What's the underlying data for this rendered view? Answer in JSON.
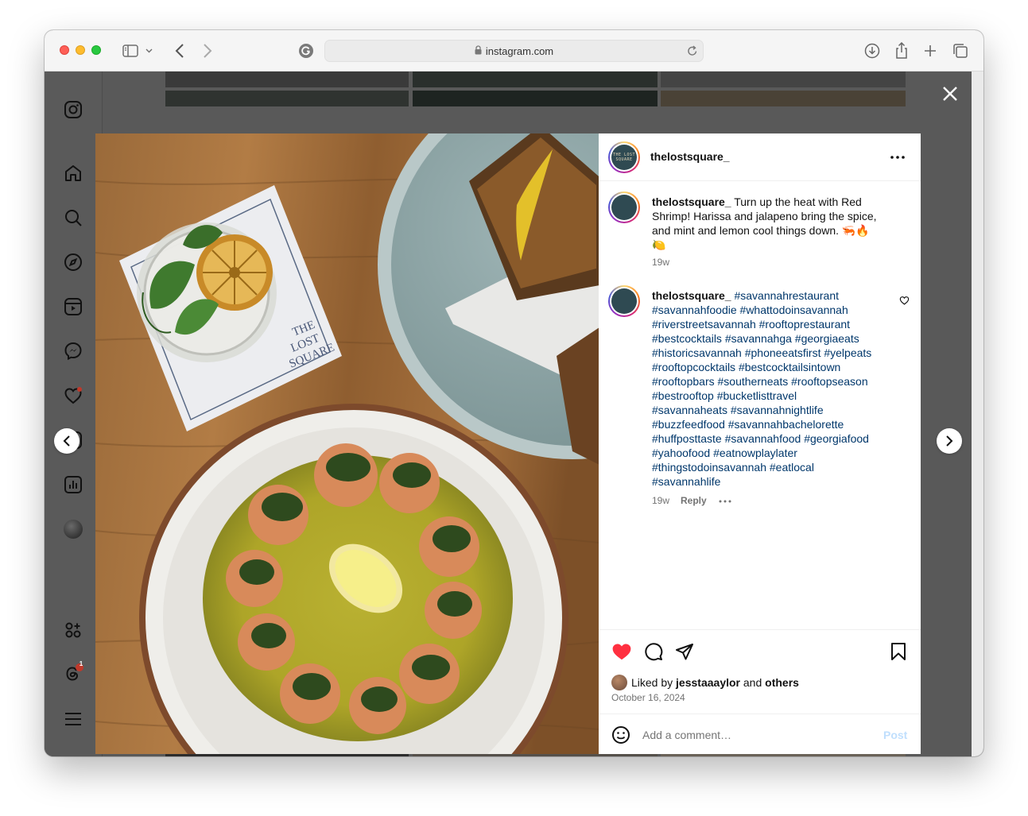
{
  "browser": {
    "url": "instagram.com"
  },
  "post": {
    "username": "thelostsquare_",
    "avatar_text": "THE LOST SQUARE",
    "caption_user": "thelostsquare_",
    "caption_line1": "Turn up the heat with Red",
    "caption_line2": "Shrimp! Harissa and jalapeno bring the spice,",
    "caption_line3": "and mint and lemon cool things down. 🦐🔥",
    "caption_line4": "🍋",
    "caption_time": "19w",
    "comment_user": "thelostsquare_",
    "hashtag_lines": [
      "#savannahrestaurant",
      "#savannahfoodie #whattodoinsavannah",
      "#riverstreetsavannah #rooftoprestaurant",
      "#bestcocktails #savannahga #georgiaeats",
      "#historicsavannah #phoneeatsfirst #yelpeats",
      "#rooftopcocktails #bestcocktailsintown",
      "#rooftopbars #southerneats #rooftopseason",
      "#bestrooftop #bucketlisttravel",
      "#savannaheats #savannahnightlife",
      "#buzzfeedfood #savannahbachelorette",
      "#huffposttaste #savannahfood #georgiafood",
      "#yahoofood #eatnowplaylater",
      "#thingstodoinsavannah #eatlocal",
      "#savannahlife"
    ],
    "comment_time": "19w",
    "reply_label": "Reply",
    "liked_prefix": "Liked by",
    "liked_user": "jesstaaaylor",
    "liked_and": "and",
    "liked_others": "others",
    "date": "October 16, 2024",
    "comment_placeholder": "Add a comment…",
    "post_label": "Post",
    "liked": true
  },
  "colors": {
    "like_red": "#ff3040",
    "post_blue_disabled": "#c0dffd"
  },
  "sidebar": {
    "notification_count": "1"
  }
}
